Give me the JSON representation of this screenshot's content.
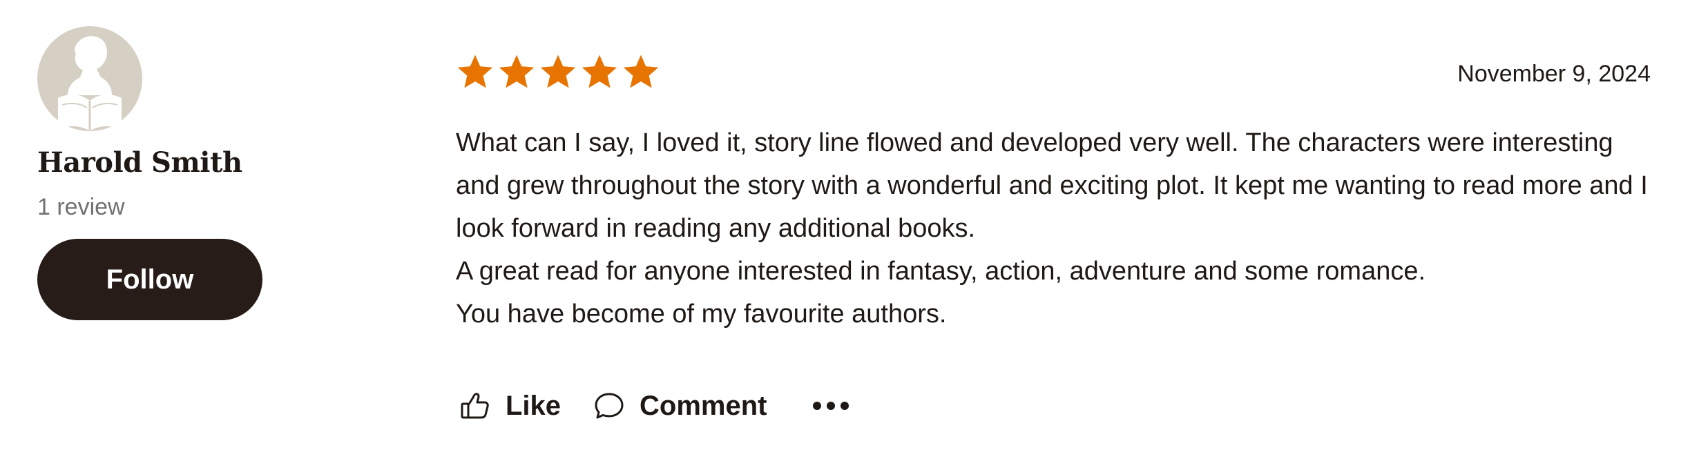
{
  "reviewer": {
    "name": "Harold Smith",
    "review_count": "1 review",
    "follow_label": "Follow",
    "avatar_icon": "default-reader-avatar-icon"
  },
  "review": {
    "rating": 5,
    "rating_max": 5,
    "star_color": "#e87400",
    "date": "November 9, 2024",
    "paragraphs": [
      "What can I say, I loved it, story line flowed and developed very well. The characters were interesting and grew throughout the story with a wonderful and exciting plot. It kept me wanting to read more and I look forward in reading any additional books.",
      "A great read for anyone interested in fantasy, action, adventure and some romance.",
      "You have become of my favourite authors."
    ]
  },
  "actions": {
    "like_label": "Like",
    "comment_label": "Comment",
    "like_icon": "thumbs-up-icon",
    "comment_icon": "speech-bubble-icon",
    "more_icon": "more-dots-icon"
  }
}
